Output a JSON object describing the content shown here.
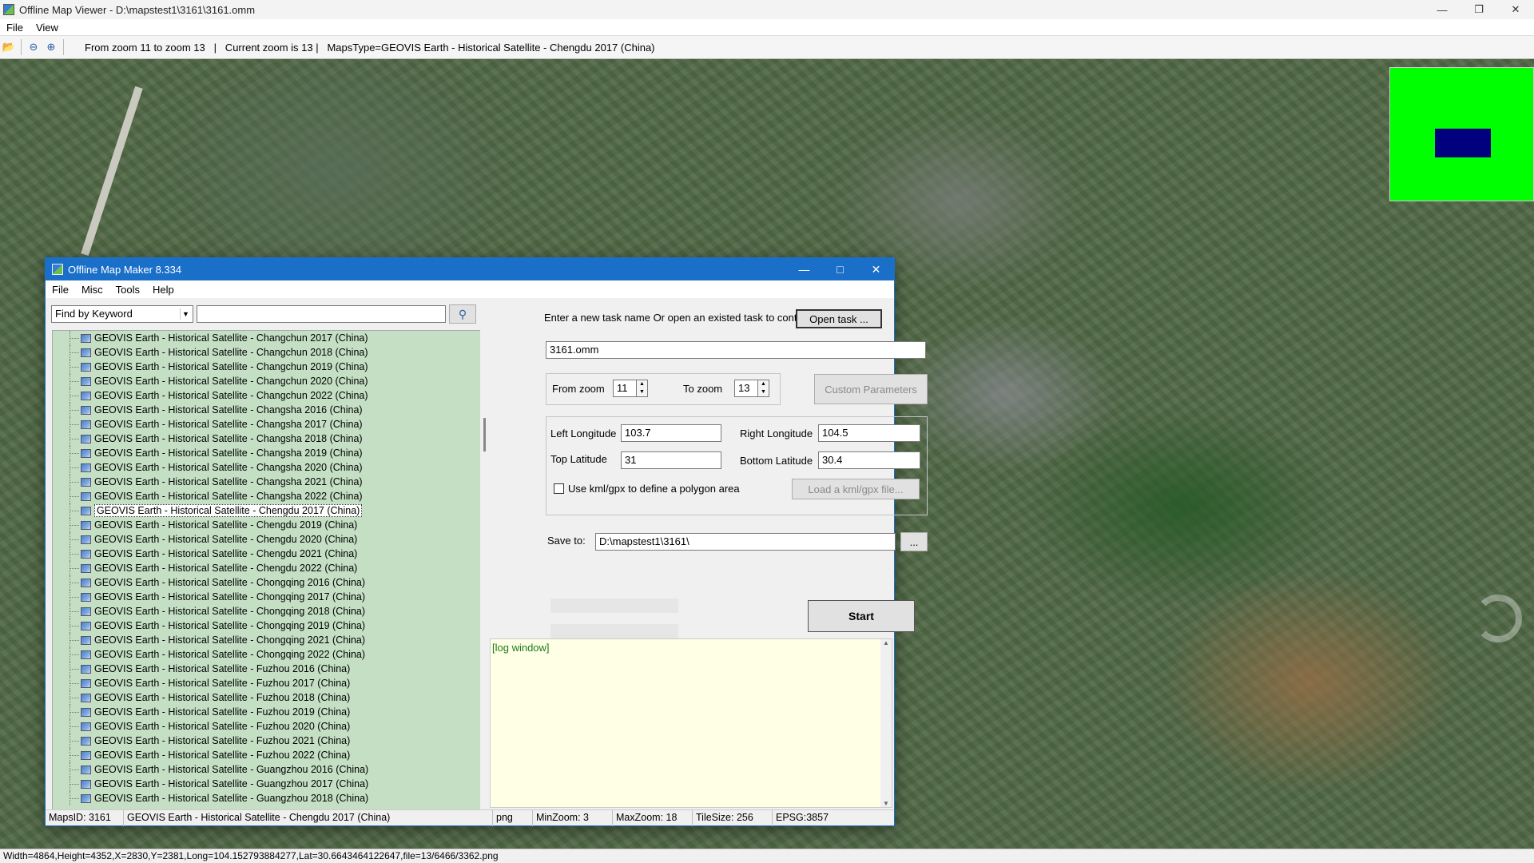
{
  "viewer": {
    "title": "Offline Map Viewer - D:\\mapstest1\\3161\\3161.omm",
    "menu": [
      "File",
      "View"
    ],
    "toolbar_status": "From zoom 11 to zoom 13   |   Current zoom is 13 |   MapsType=GEOVIS Earth - Historical Satellite - Chengdu 2017 (China)",
    "statusbar": "Width=4864,Height=4352,X=2830,Y=2381,Long=104.152793884277,Lat=30.6643464122647,file=13/6466/3362.png",
    "colors": {
      "overview_bg": "#00ff00",
      "overview_rect": "#00007f"
    }
  },
  "dialog": {
    "title": "Offline Map Maker 8.334",
    "menu": [
      "File",
      "Misc",
      "Tools",
      "Help"
    ],
    "find": {
      "mode": "Find by Keyword",
      "query": ""
    },
    "tree_items": [
      "GEOVIS Earth - Historical Satellite - Changchun 2017 (China)",
      "GEOVIS Earth - Historical Satellite - Changchun 2018 (China)",
      "GEOVIS Earth - Historical Satellite - Changchun 2019 (China)",
      "GEOVIS Earth - Historical Satellite - Changchun 2020 (China)",
      "GEOVIS Earth - Historical Satellite - Changchun 2022 (China)",
      "GEOVIS Earth - Historical Satellite - Changsha 2016 (China)",
      "GEOVIS Earth - Historical Satellite - Changsha 2017 (China)",
      "GEOVIS Earth - Historical Satellite - Changsha 2018 (China)",
      "GEOVIS Earth - Historical Satellite - Changsha 2019 (China)",
      "GEOVIS Earth - Historical Satellite - Changsha 2020 (China)",
      "GEOVIS Earth - Historical Satellite - Changsha 2021 (China)",
      "GEOVIS Earth - Historical Satellite - Changsha 2022 (China)",
      "GEOVIS Earth - Historical Satellite - Chengdu 2017 (China)",
      "GEOVIS Earth - Historical Satellite - Chengdu 2019 (China)",
      "GEOVIS Earth - Historical Satellite - Chengdu 2020 (China)",
      "GEOVIS Earth - Historical Satellite - Chengdu 2021 (China)",
      "GEOVIS Earth - Historical Satellite - Chengdu 2022 (China)",
      "GEOVIS Earth - Historical Satellite - Chongqing 2016 (China)",
      "GEOVIS Earth - Historical Satellite - Chongqing 2017 (China)",
      "GEOVIS Earth - Historical Satellite - Chongqing 2018 (China)",
      "GEOVIS Earth - Historical Satellite - Chongqing 2019 (China)",
      "GEOVIS Earth - Historical Satellite - Chongqing 2021 (China)",
      "GEOVIS Earth - Historical Satellite - Chongqing 2022 (China)",
      "GEOVIS Earth - Historical Satellite - Fuzhou 2016 (China)",
      "GEOVIS Earth - Historical Satellite - Fuzhou 2017 (China)",
      "GEOVIS Earth - Historical Satellite - Fuzhou 2018 (China)",
      "GEOVIS Earth - Historical Satellite - Fuzhou 2019 (China)",
      "GEOVIS Earth - Historical Satellite - Fuzhou 2020 (China)",
      "GEOVIS Earth - Historical Satellite - Fuzhou 2021 (China)",
      "GEOVIS Earth - Historical Satellite - Fuzhou 2022 (China)",
      "GEOVIS Earth - Historical Satellite - Guangzhou 2016 (China)",
      "GEOVIS Earth - Historical Satellite - Guangzhou 2017 (China)",
      "GEOVIS Earth - Historical Satellite - Guangzhou 2018 (China)"
    ],
    "selected_item": "GEOVIS Earth - Historical Satellite - Chengdu 2017 (China)",
    "task_prompt": "Enter a new task name Or open an existed task to continue:",
    "open_task_label": "Open task ...",
    "task_name": "3161.omm",
    "from_zoom_label": "From zoom",
    "from_zoom": "11",
    "to_zoom_label": "To zoom",
    "to_zoom": "13",
    "custom_params_label": "Custom Parameters",
    "left_lon_label": "Left Longitude",
    "left_lon": "103.7",
    "right_lon_label": "Right Longitude",
    "right_lon": "104.5",
    "top_lat_label": "Top Latitude",
    "top_lat": "31",
    "bottom_lat_label": "Bottom Latitude",
    "bottom_lat": "30.4",
    "kml_label": "Use kml/gpx to define a polygon area",
    "load_kml_label": "Load a kml/gpx file...",
    "save_to_label": "Save to:",
    "save_to": "D:\\mapstest1\\3161\\",
    "browse_label": "...",
    "start_label": "Start",
    "log_text": "[log window]",
    "status": {
      "maps_id": "MapsID: 3161",
      "maps_name": "GEOVIS Earth - Historical Satellite - Chengdu 2017 (China)",
      "format": "png",
      "min_zoom": "MinZoom: 3",
      "max_zoom": "MaxZoom: 18",
      "tile_size": "TileSize: 256",
      "epsg": "EPSG:3857"
    }
  }
}
